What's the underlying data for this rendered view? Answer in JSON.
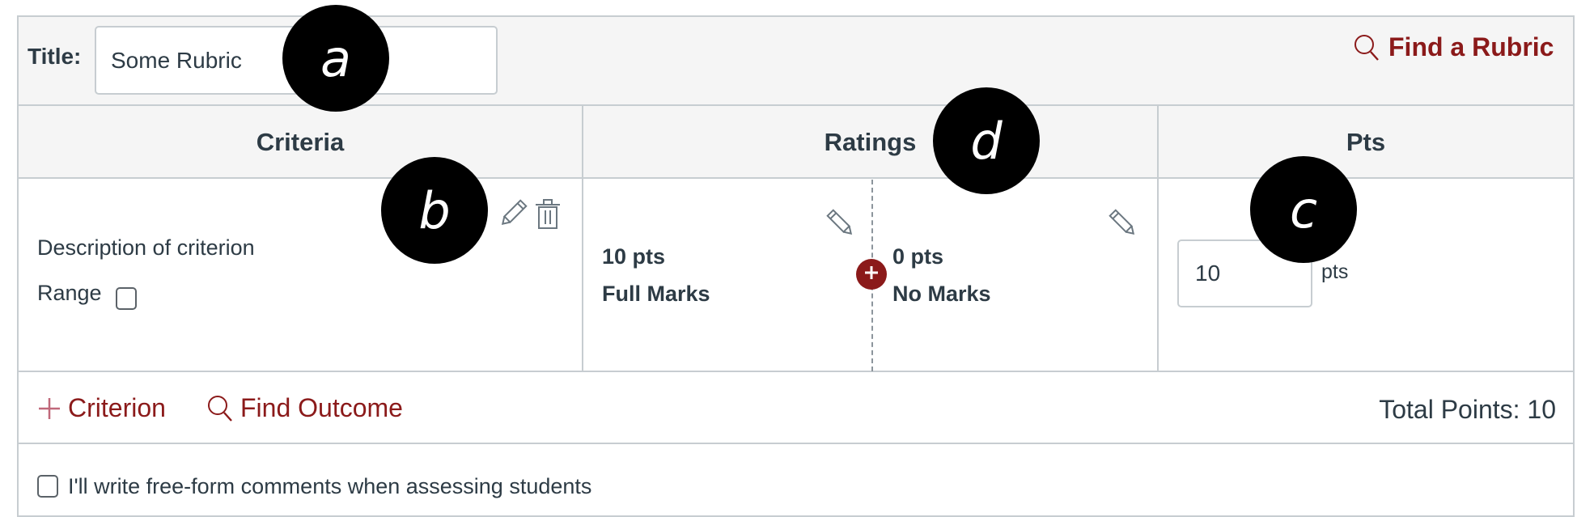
{
  "header": {
    "title_label": "Title:",
    "title_value": "Some Rubric",
    "find_rubric_label": "Find a Rubric",
    "find_rubric_icon": "search-icon"
  },
  "table": {
    "columns": [
      "Criteria",
      "Ratings",
      "Pts"
    ],
    "criterion": {
      "description": "Description of criterion",
      "range_label": "Range",
      "range_checked": false,
      "actions": [
        "edit-icon",
        "trash-icon"
      ]
    },
    "ratings": [
      {
        "points": "10 pts",
        "label": "Full Marks"
      },
      {
        "points": "0 pts",
        "label": "No Marks"
      }
    ],
    "points": {
      "value": "10",
      "unit": "pts"
    }
  },
  "footer": {
    "add_criterion_label": "Criterion",
    "find_outcome_label": "Find Outcome",
    "total_points_label": "Total Points: 10"
  },
  "options": {
    "free_form_label": "I'll write free-form comments when assessing students",
    "free_form_checked": false
  },
  "annotations": [
    "a",
    "b",
    "c",
    "d"
  ],
  "colors": {
    "accent": "#8b1a1a",
    "text": "#2d3b45",
    "border": "#c7cdd1",
    "header_bg": "#f5f5f5"
  }
}
